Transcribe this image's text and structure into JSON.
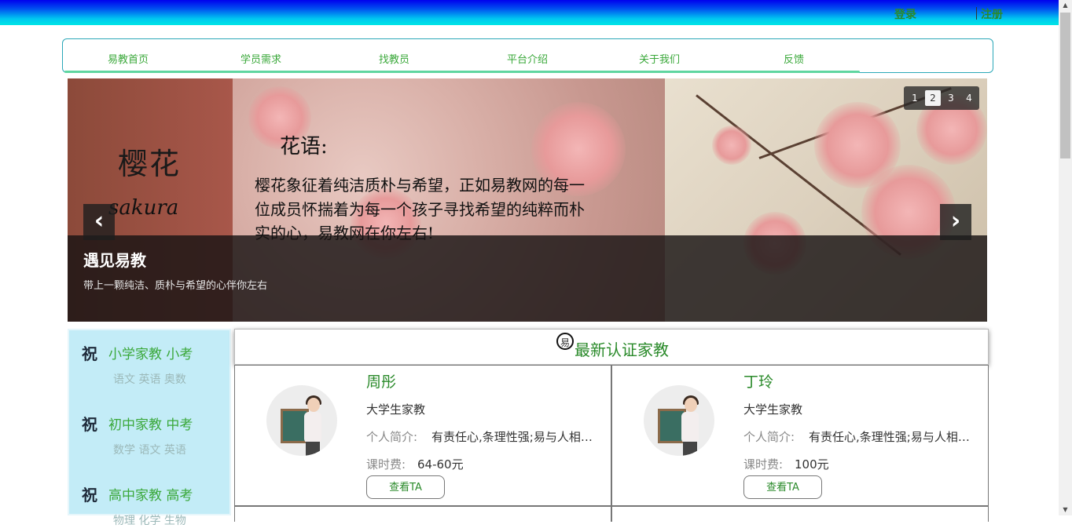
{
  "header": {
    "login": "登录",
    "register": "注册"
  },
  "nav": {
    "items": [
      "易教首页",
      "学员需求",
      "找教员",
      "平台介绍",
      "关于我们",
      "反馈"
    ]
  },
  "carousel": {
    "slide_art": {
      "title": "樱花",
      "roman": "sakura",
      "poem_head": "花语:",
      "poem_lines": [
        "樱花象征着纯洁质朴与希望，正如易教网的每一",
        "位成员怀揣着为每一个孩子寻找希望的纯粹而朴",
        "实的心，易教网在你左右!"
      ]
    },
    "caption_title": "遇见易教",
    "caption_sub": "带上一颗纯洁、质朴与希望的心伴你左右",
    "prev": "‹",
    "next": "›",
    "pages": [
      "1",
      "2",
      "3",
      "4"
    ],
    "active_page": 2
  },
  "categories": [
    {
      "icon": "祝",
      "title": "小学家教 小考",
      "sub": "语文 英语 奥数"
    },
    {
      "icon": "祝",
      "title": "初中家教 中考",
      "sub": "数学 语文 英语"
    },
    {
      "icon": "祝",
      "title": "高中家教 高考",
      "sub": "物理 化学 生物"
    }
  ],
  "teachers_panel": {
    "logo": "易",
    "title": "最新认证家教",
    "intro_label": "个人简介:",
    "fee_label": "课时费:",
    "button": "查看TA",
    "teachers": [
      {
        "name": "周彤",
        "type": "大学生家教",
        "intro": "有责任心,条理性强;易与人相处,善于沟通",
        "fee": "64-60元"
      },
      {
        "name": "丁玲",
        "type": "大学生家教",
        "intro": "有责任心,条理性强;易与人相处,善于沟通",
        "fee": "100元"
      }
    ]
  },
  "colors": {
    "accent_green": "#2a8a2a",
    "sidebar_bg": "#c3ecf7",
    "nav_border": "#2ba8b8"
  }
}
